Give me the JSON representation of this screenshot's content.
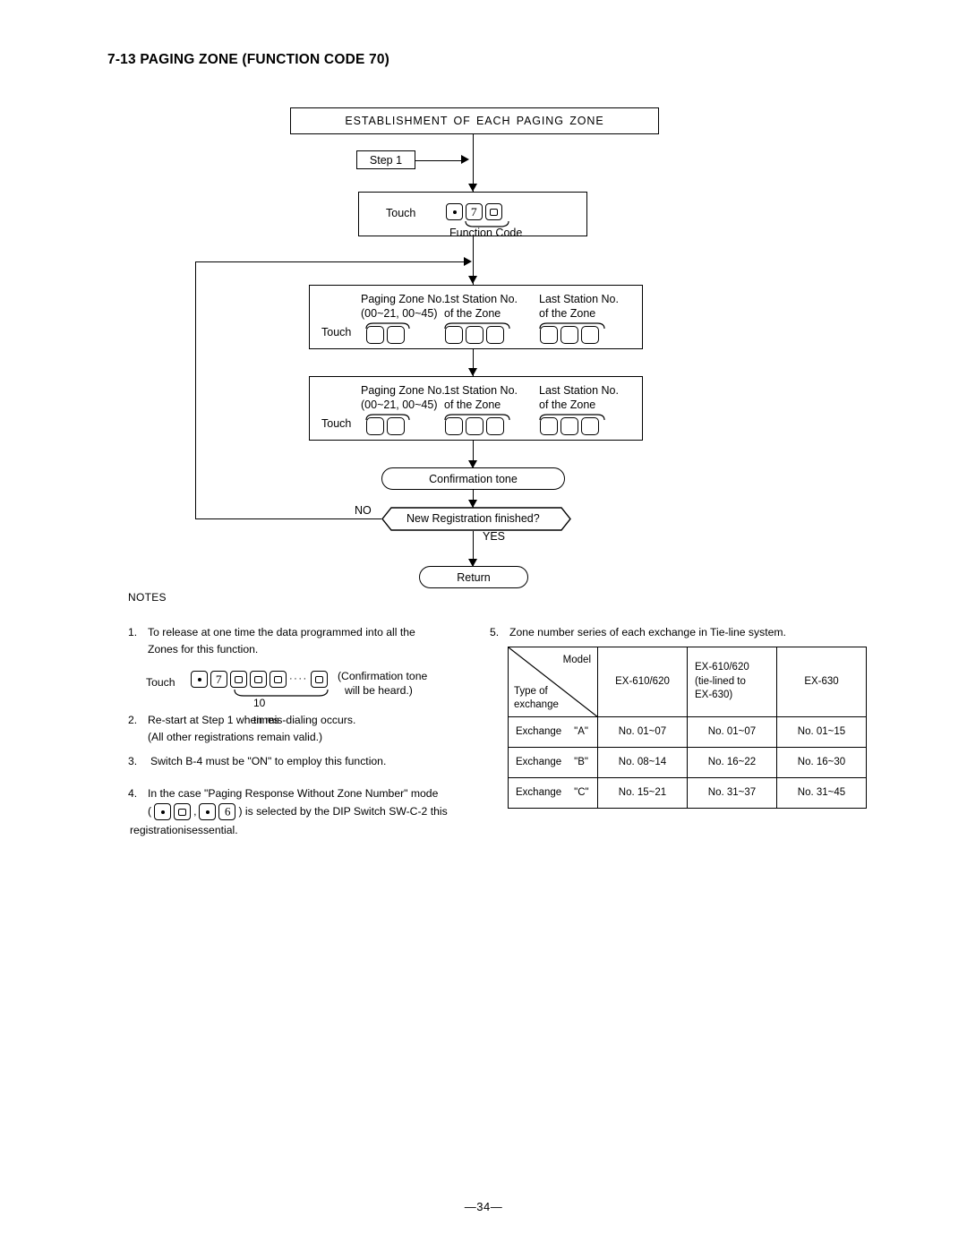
{
  "document": {
    "section_title": "7-13 PAGING ZONE (FUNCTION CODE 70)",
    "page_number": "—34—"
  },
  "flowchart": {
    "title_bar": "ESTABLISHMENT OF EACH PAGING ZONE",
    "step_box": "Step 1",
    "function_code_box": {
      "touch_label": "Touch",
      "caption": "Function  Code",
      "keys": [
        "dot-key",
        "7-key",
        "0-key"
      ]
    },
    "zone_entry_1": {
      "touch_label": "Touch",
      "col1_line1": "Paging Zone No.",
      "col1_line2": "(00~21, 00~45)",
      "col2_line1": "1st Station  No.",
      "col2_line2": "of the Zone",
      "col3_line1": "Last Station  No.",
      "col3_line2": "of the Zone",
      "col1_key_count": 2,
      "col2_key_count": 3,
      "col3_key_count": 3
    },
    "zone_entry_2": {
      "touch_label": "Touch",
      "col1_line1": "Paging Zone No.",
      "col1_line2": "(00~21, 00~45)",
      "col2_line1": "1st Station  No.",
      "col2_line2": "of the Zone",
      "col3_line1": "Last Station  No.",
      "col3_line2": "of the Zone",
      "col1_key_count": 2,
      "col2_key_count": 3,
      "col3_key_count": 3
    },
    "confirmation_tone": "Confirmation tone",
    "decision": "New Registration finished?",
    "decision_no": "NO",
    "decision_yes": "YES",
    "return": "Return"
  },
  "notes": {
    "heading": "NOTES",
    "note1": {
      "number": "1.",
      "line1": "To release at one time the data programmed into all the",
      "line2": "Zones for this function.",
      "touch_label": "Touch",
      "repeat_caption": "10 times",
      "confirm_line1": "(Confirmation tone",
      "confirm_line2": "will be heard.)"
    },
    "note2": {
      "number": "2.",
      "line1": "Re-start at Step 1  when  mis-dialing occurs.",
      "line2": "(All  other  registrations  remain  valid.)"
    },
    "note3": {
      "number": "3.",
      "line1": "Switch  B-4 must  be  \"ON\" to employ  this function."
    },
    "note4": {
      "number": "4.",
      "line1": "In the case \"Paging Response Without Zone Number\" mode",
      "line2_a": "(",
      "line2_b": ",",
      "line2_c": ") is selected by the DIP Switch SW-C-2 this",
      "line3": "registrationisessential."
    },
    "note5": {
      "number": "5.",
      "line1": "Zone number series of each exchange in Tie-line system."
    }
  },
  "table": {
    "corner_model_label": "Model",
    "corner_type_line1": "Type of",
    "corner_type_line2": "exchange",
    "columns": [
      "EX-610/620",
      "EX-610/620\n(tie-lined  to\nEX-630)",
      "EX-630"
    ],
    "col2_line1": "EX-610/620",
    "col2_line2": "(tie-lined  to",
    "col2_line3": "EX-630)",
    "rows": [
      {
        "label_prefix": "Exchange",
        "label_quoted": "\"A\"",
        "cells": [
          "No. 01~07",
          "No. 01~07",
          "No.  01~15"
        ]
      },
      {
        "label_prefix": "Exchange",
        "label_quoted": "\"B\"",
        "cells": [
          "No. 08~14",
          "No.  16~22",
          "No. 16~30"
        ]
      },
      {
        "label_prefix": "Exchange",
        "label_quoted": "\"C\"",
        "cells": [
          "No.  15~21",
          "No. 31~37",
          "No. 31~45"
        ]
      }
    ]
  }
}
